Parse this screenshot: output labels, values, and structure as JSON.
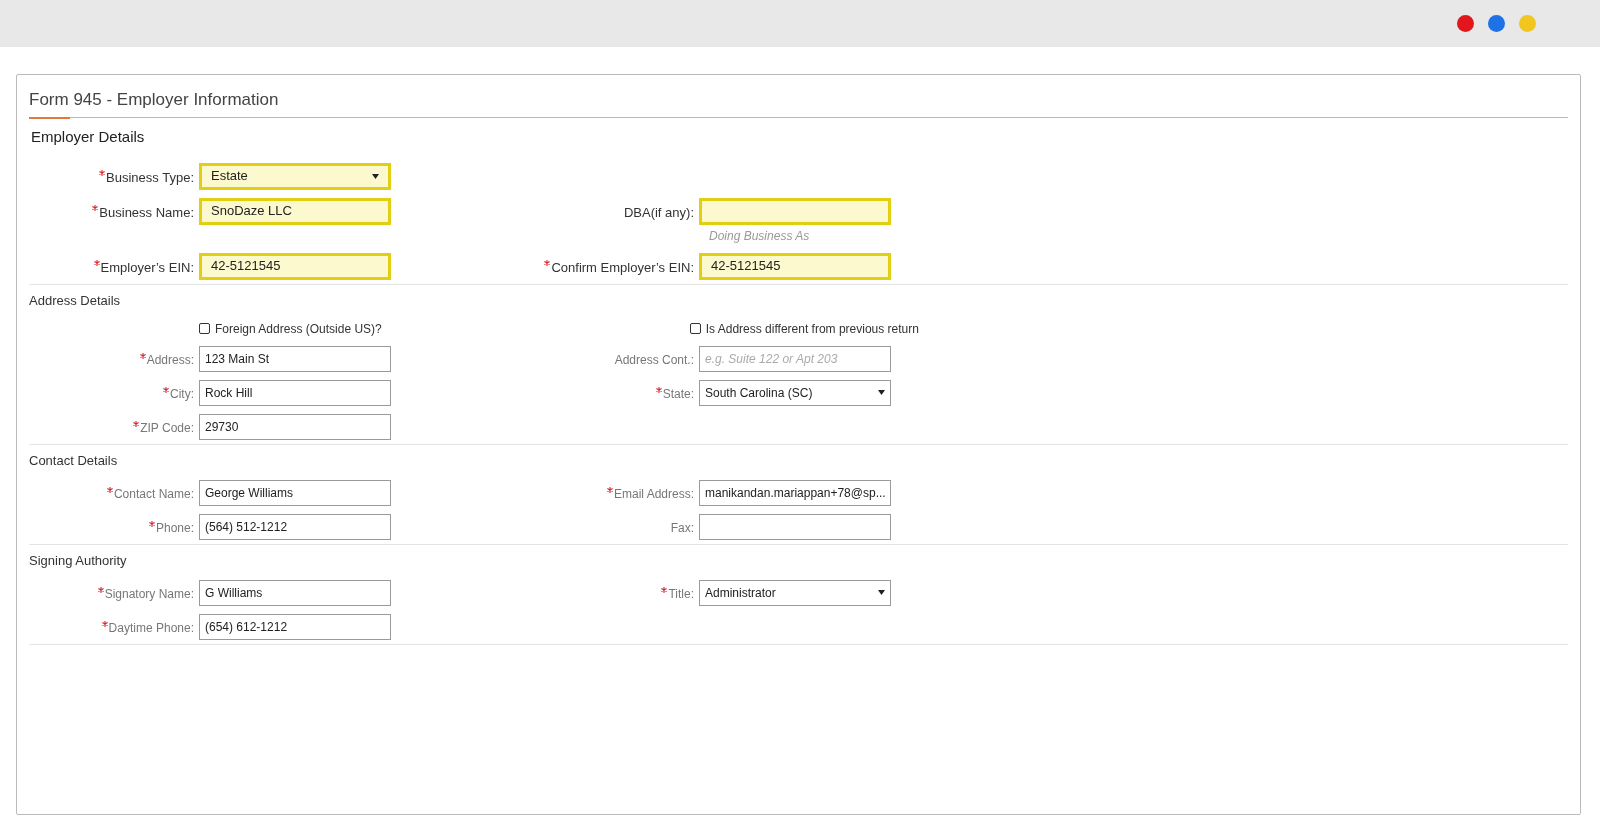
{
  "window": {
    "controls": [
      {
        "color": "#e3161b"
      },
      {
        "color": "#1f72e6"
      },
      {
        "color": "#f0c61f"
      }
    ]
  },
  "form": {
    "title": "Form 945 - Employer Information",
    "sections": [
      {
        "title": "Employer Details",
        "kind": "main",
        "rows": [
          [
            {
              "kind": "select",
              "label": "Business Type:",
              "required": true,
              "value": "Estate",
              "highlighted": true
            }
          ],
          [
            {
              "kind": "text",
              "label": "Business Name:",
              "required": true,
              "value": "SnoDaze LLC",
              "highlighted": true
            },
            {
              "kind": "text",
              "label": "DBA(if any):",
              "required": false,
              "highlighted": true,
              "hint": "Doing Business As"
            }
          ],
          [
            {
              "kind": "text",
              "label": "Employer’s EIN:",
              "required": true,
              "value": "42-5121545",
              "highlighted": true
            },
            {
              "kind": "text",
              "label": "Confirm Employer’s EIN:",
              "required": true,
              "value": "42-5121545",
              "highlighted": true
            }
          ]
        ]
      },
      {
        "title": "Address Details",
        "kind": "sub",
        "rows": [
          [
            {
              "kind": "checkbox",
              "label": "Foreign Address (Outside US)?",
              "checked": false
            },
            {
              "kind": "checkbox",
              "label": "Is Address different from previous return",
              "checked": false
            }
          ],
          [
            {
              "kind": "text",
              "label": "Address:",
              "required": true,
              "value": "123 Main St",
              "highlighted": false
            },
            {
              "kind": "text",
              "label": "Address Cont.:",
              "required": false,
              "placeholder": "e.g. Suite 122 or Apt 203",
              "highlighted": false
            }
          ],
          [
            {
              "kind": "text",
              "label": "City:",
              "required": true,
              "value": "Rock Hill",
              "highlighted": false
            },
            {
              "kind": "select",
              "label": "State:",
              "required": true,
              "value": "South Carolina (SC)",
              "highlighted": false
            }
          ],
          [
            {
              "kind": "text",
              "label": "ZIP Code:",
              "required": true,
              "value": "29730",
              "highlighted": false
            }
          ]
        ]
      },
      {
        "title": "Contact Details",
        "kind": "sub",
        "rows": [
          [
            {
              "kind": "text",
              "label": "Contact Name:",
              "required": true,
              "value": "George Williams",
              "highlighted": false
            },
            {
              "kind": "text",
              "label": "Email Address:",
              "required": true,
              "value": "manikandan.mariappan+78@sp...",
              "highlighted": false
            }
          ],
          [
            {
              "kind": "text",
              "label": "Phone:",
              "required": true,
              "value": "(564) 512-1212",
              "highlighted": false
            },
            {
              "kind": "text",
              "label": "Fax:",
              "required": false,
              "highlighted": false
            }
          ]
        ]
      },
      {
        "title": "Signing Authority",
        "kind": "sub",
        "rows": [
          [
            {
              "kind": "text",
              "label": "Signatory Name:",
              "required": true,
              "value": "G Williams",
              "highlighted": false
            },
            {
              "kind": "select",
              "label": "Title:",
              "required": true,
              "value": "Administrator",
              "highlighted": false
            }
          ],
          [
            {
              "kind": "text",
              "label": "Daytime Phone:",
              "required": true,
              "value": "(654) 612-1212",
              "highlighted": false
            }
          ]
        ]
      }
    ]
  }
}
